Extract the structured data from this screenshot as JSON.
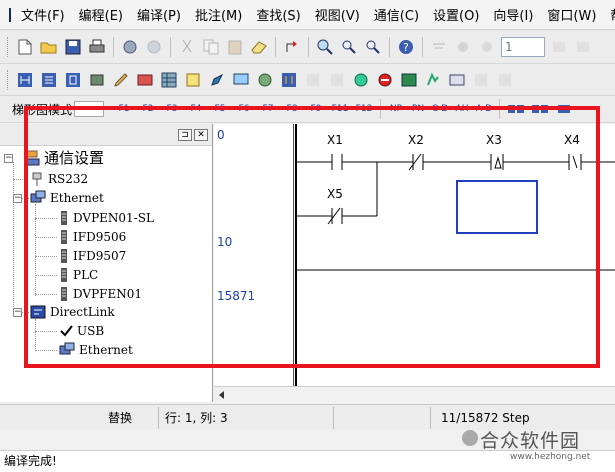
{
  "menu": [
    "文件(F)",
    "编程(E)",
    "编译(P)",
    "批注(M)",
    "查找(S)",
    "视图(V)",
    "通信(C)",
    "设置(O)",
    "向导(I)",
    "窗口(W)",
    "帮助"
  ],
  "toolbar": {
    "spin_value": "1"
  },
  "fkeys": [
    "F1",
    "F2",
    "F3",
    "F4",
    "F5",
    "F6",
    "F7",
    "F8",
    "F9",
    "F11",
    "F12"
  ],
  "fkeys2": [
    "NP",
    "PN",
    "C-D",
    "AH",
    "A-D"
  ],
  "status_label": "梯形图模式",
  "tree": {
    "root": "通信设置",
    "rs232": "RS232",
    "ethernet": "Ethernet",
    "ethernet_children": [
      "DVPEN01-SL",
      "IFD9506",
      "IFD9507",
      "PLC",
      "DVPFEN01"
    ],
    "directlink": "DirectLink",
    "directlink_children": [
      "USB",
      "Ethernet"
    ]
  },
  "line_numbers": [
    "0",
    "10",
    "15871"
  ],
  "ladder": {
    "contacts": [
      "X1",
      "X2",
      "X3",
      "X4",
      "X5"
    ]
  },
  "statusbar": {
    "mode": "替换",
    "position": "行: 1, 列: 3",
    "steps": "11/15872 Step"
  },
  "output_text": "编译完成!",
  "watermark": {
    "title": "合众软件园",
    "url": "www.hezhong.net"
  },
  "colors": {
    "highlight": "#e8141e",
    "cursor": "#2040c0",
    "linenum": "#1a3fa8"
  }
}
